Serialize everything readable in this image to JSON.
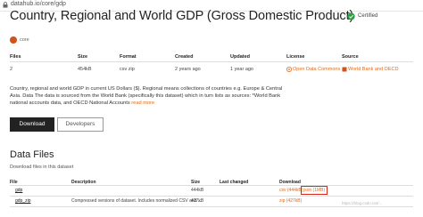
{
  "browser": {
    "url": "datahub.io/core/gdp"
  },
  "page": {
    "title": "Country, Regional and World GDP (Gross Domestic Product)",
    "certified_label": "Certified",
    "owner": "core"
  },
  "meta": {
    "headers": [
      "Files",
      "Size",
      "Format",
      "Created",
      "Updated",
      "License",
      "Source"
    ],
    "values": {
      "files": "2",
      "size": "454kB",
      "format": "csv zip",
      "created": "2 years ago",
      "updated": "1 year ago",
      "license": "Open Data Commons ...",
      "source": "World Bank and OECD"
    }
  },
  "description": {
    "text": "Country, regional and world GDP in current US Dollars ($). Regional means collections of countries e.g. Europe & Central Asia. Data The data is sourced from the World Bank (specifically this dataset) which in turn lists as sources: *World Bank national accounts data, and OECD National Accounts",
    "read_more": "read more"
  },
  "buttons": {
    "download": "Download",
    "developers": "Developers"
  },
  "data_files": {
    "title": "Data Files",
    "subtitle": "Download files in this dataset",
    "headers": [
      "File",
      "Description",
      "Size",
      "Last changed",
      "Download"
    ],
    "rows": [
      {
        "file": "gdp",
        "description": "",
        "size": "444kB",
        "last_changed": "",
        "csv": "csv (444kB)",
        "json": "json (1MB)"
      },
      {
        "file": "gdp_zip",
        "description": "Compressed versions of dataset. Includes normalized CSV and ...",
        "size": "427kB",
        "last_changed": "",
        "zip": "zip (427kB)"
      }
    ]
  },
  "watermark": "https://blog.csdn.net/...",
  "colors": {
    "accent": "#e06a1b",
    "highlight": "#d9281a",
    "button_dark": "#222222"
  }
}
